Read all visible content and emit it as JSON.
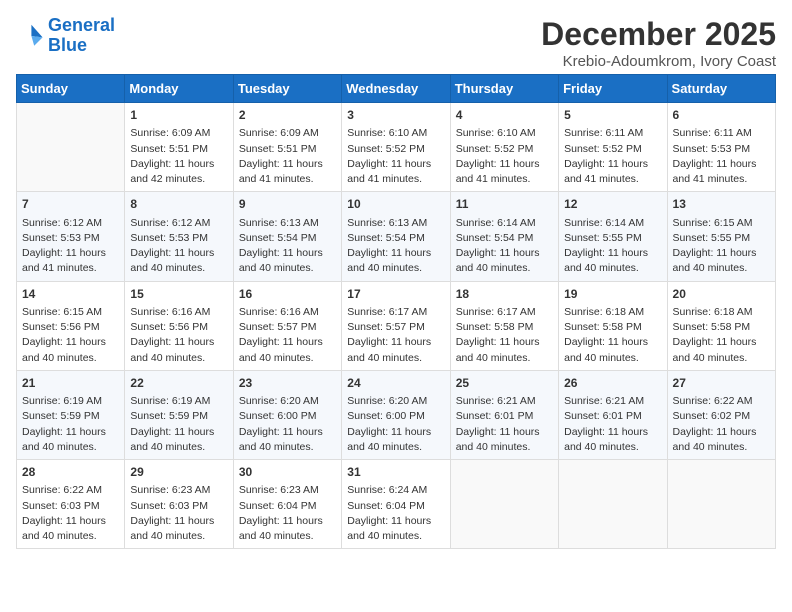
{
  "header": {
    "logo_line1": "General",
    "logo_line2": "Blue",
    "month": "December 2025",
    "location": "Krebio-Adoumkrom, Ivory Coast"
  },
  "weekdays": [
    "Sunday",
    "Monday",
    "Tuesday",
    "Wednesday",
    "Thursday",
    "Friday",
    "Saturday"
  ],
  "weeks": [
    [
      {
        "day": "",
        "info": ""
      },
      {
        "day": "1",
        "info": "Sunrise: 6:09 AM\nSunset: 5:51 PM\nDaylight: 11 hours\nand 42 minutes."
      },
      {
        "day": "2",
        "info": "Sunrise: 6:09 AM\nSunset: 5:51 PM\nDaylight: 11 hours\nand 41 minutes."
      },
      {
        "day": "3",
        "info": "Sunrise: 6:10 AM\nSunset: 5:52 PM\nDaylight: 11 hours\nand 41 minutes."
      },
      {
        "day": "4",
        "info": "Sunrise: 6:10 AM\nSunset: 5:52 PM\nDaylight: 11 hours\nand 41 minutes."
      },
      {
        "day": "5",
        "info": "Sunrise: 6:11 AM\nSunset: 5:52 PM\nDaylight: 11 hours\nand 41 minutes."
      },
      {
        "day": "6",
        "info": "Sunrise: 6:11 AM\nSunset: 5:53 PM\nDaylight: 11 hours\nand 41 minutes."
      }
    ],
    [
      {
        "day": "7",
        "info": "Sunrise: 6:12 AM\nSunset: 5:53 PM\nDaylight: 11 hours\nand 41 minutes."
      },
      {
        "day": "8",
        "info": "Sunrise: 6:12 AM\nSunset: 5:53 PM\nDaylight: 11 hours\nand 40 minutes."
      },
      {
        "day": "9",
        "info": "Sunrise: 6:13 AM\nSunset: 5:54 PM\nDaylight: 11 hours\nand 40 minutes."
      },
      {
        "day": "10",
        "info": "Sunrise: 6:13 AM\nSunset: 5:54 PM\nDaylight: 11 hours\nand 40 minutes."
      },
      {
        "day": "11",
        "info": "Sunrise: 6:14 AM\nSunset: 5:54 PM\nDaylight: 11 hours\nand 40 minutes."
      },
      {
        "day": "12",
        "info": "Sunrise: 6:14 AM\nSunset: 5:55 PM\nDaylight: 11 hours\nand 40 minutes."
      },
      {
        "day": "13",
        "info": "Sunrise: 6:15 AM\nSunset: 5:55 PM\nDaylight: 11 hours\nand 40 minutes."
      }
    ],
    [
      {
        "day": "14",
        "info": "Sunrise: 6:15 AM\nSunset: 5:56 PM\nDaylight: 11 hours\nand 40 minutes."
      },
      {
        "day": "15",
        "info": "Sunrise: 6:16 AM\nSunset: 5:56 PM\nDaylight: 11 hours\nand 40 minutes."
      },
      {
        "day": "16",
        "info": "Sunrise: 6:16 AM\nSunset: 5:57 PM\nDaylight: 11 hours\nand 40 minutes."
      },
      {
        "day": "17",
        "info": "Sunrise: 6:17 AM\nSunset: 5:57 PM\nDaylight: 11 hours\nand 40 minutes."
      },
      {
        "day": "18",
        "info": "Sunrise: 6:17 AM\nSunset: 5:58 PM\nDaylight: 11 hours\nand 40 minutes."
      },
      {
        "day": "19",
        "info": "Sunrise: 6:18 AM\nSunset: 5:58 PM\nDaylight: 11 hours\nand 40 minutes."
      },
      {
        "day": "20",
        "info": "Sunrise: 6:18 AM\nSunset: 5:58 PM\nDaylight: 11 hours\nand 40 minutes."
      }
    ],
    [
      {
        "day": "21",
        "info": "Sunrise: 6:19 AM\nSunset: 5:59 PM\nDaylight: 11 hours\nand 40 minutes."
      },
      {
        "day": "22",
        "info": "Sunrise: 6:19 AM\nSunset: 5:59 PM\nDaylight: 11 hours\nand 40 minutes."
      },
      {
        "day": "23",
        "info": "Sunrise: 6:20 AM\nSunset: 6:00 PM\nDaylight: 11 hours\nand 40 minutes."
      },
      {
        "day": "24",
        "info": "Sunrise: 6:20 AM\nSunset: 6:00 PM\nDaylight: 11 hours\nand 40 minutes."
      },
      {
        "day": "25",
        "info": "Sunrise: 6:21 AM\nSunset: 6:01 PM\nDaylight: 11 hours\nand 40 minutes."
      },
      {
        "day": "26",
        "info": "Sunrise: 6:21 AM\nSunset: 6:01 PM\nDaylight: 11 hours\nand 40 minutes."
      },
      {
        "day": "27",
        "info": "Sunrise: 6:22 AM\nSunset: 6:02 PM\nDaylight: 11 hours\nand 40 minutes."
      }
    ],
    [
      {
        "day": "28",
        "info": "Sunrise: 6:22 AM\nSunset: 6:03 PM\nDaylight: 11 hours\nand 40 minutes."
      },
      {
        "day": "29",
        "info": "Sunrise: 6:23 AM\nSunset: 6:03 PM\nDaylight: 11 hours\nand 40 minutes."
      },
      {
        "day": "30",
        "info": "Sunrise: 6:23 AM\nSunset: 6:04 PM\nDaylight: 11 hours\nand 40 minutes."
      },
      {
        "day": "31",
        "info": "Sunrise: 6:24 AM\nSunset: 6:04 PM\nDaylight: 11 hours\nand 40 minutes."
      },
      {
        "day": "",
        "info": ""
      },
      {
        "day": "",
        "info": ""
      },
      {
        "day": "",
        "info": ""
      }
    ]
  ]
}
